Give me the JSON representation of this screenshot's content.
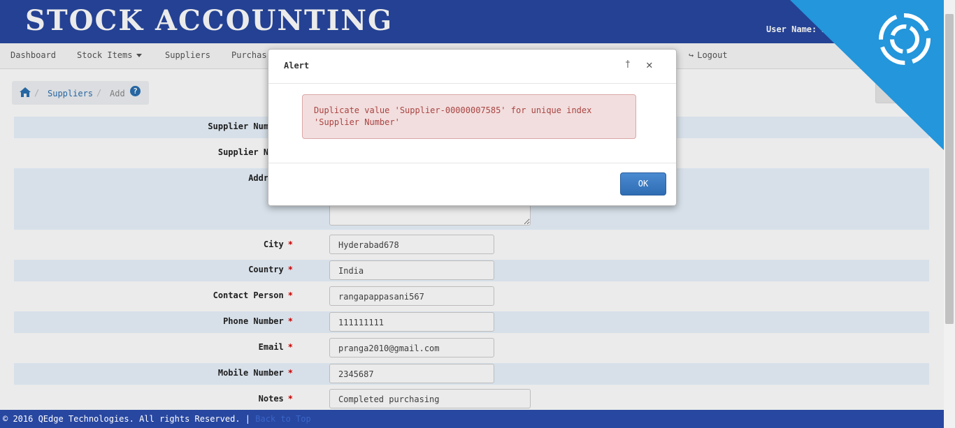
{
  "header": {
    "brand": "STOCK ACCOUNTING",
    "user_label": "User Name: A"
  },
  "nav": {
    "items": [
      "Dashboard",
      "Stock Items",
      "Suppliers",
      "Purchas",
      "Logout"
    ]
  },
  "breadcrumb": {
    "link": "Suppliers",
    "current": "Add",
    "help": "?"
  },
  "form": {
    "supplier_number_label": "Supplier Number",
    "supplier_name_label": "Supplier Name",
    "address_label": "Address",
    "city_label": "City",
    "city_value": "Hyderabad678",
    "country_label": "Country",
    "country_value": "India",
    "contact_label": "Contact Person",
    "contact_value": "rangapappasani567",
    "phone_label": "Phone Number",
    "phone_value": "111111111",
    "email_label": "Email",
    "email_value": "pranga2010@gmail.com",
    "mobile_label": "Mobile Number",
    "mobile_value": "2345687",
    "notes_label": "Notes",
    "notes_value": "Completed purchasing",
    "required_mark": "*"
  },
  "modal": {
    "title": "Alert",
    "message": "Duplicate value 'Supplier-00000007585' for unique index 'Supplier Number'",
    "ok_label": "OK",
    "pin": "†",
    "close": "✕"
  },
  "footer": {
    "copyright": "© 2016 QEdge Technologies. All rights Reserved. |",
    "back_to_top": "Back to Top"
  },
  "colors": {
    "header_bg": "#2847a0",
    "corner_bg": "#2396dc",
    "row_alt": "#eaf3fd",
    "alert_bg": "#f2dede",
    "alert_text": "#a94442",
    "ok_button": "#3a7bc8"
  }
}
